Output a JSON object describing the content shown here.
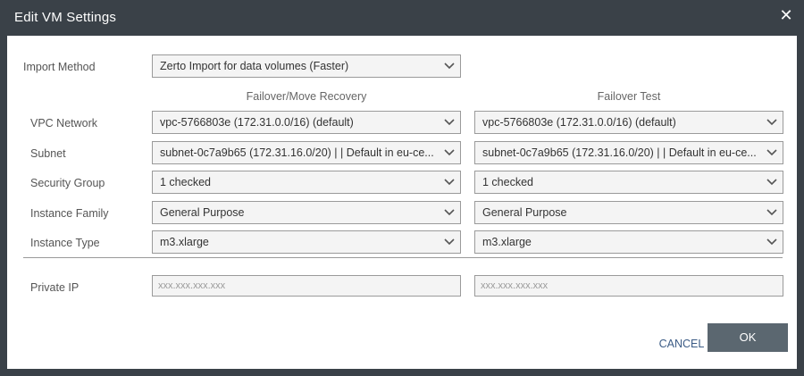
{
  "dialog": {
    "title": "Edit VM Settings",
    "close_glyph": "✕"
  },
  "import_method": {
    "label": "Import Method",
    "value": "Zerto Import for data volumes (Faster)"
  },
  "columns": {
    "recovery": "Failover/Move Recovery",
    "test": "Failover Test"
  },
  "rows": {
    "vpc": {
      "label": "VPC Network",
      "recovery": "vpc-5766803e (172.31.0.0/16) (default)",
      "test": "vpc-5766803e (172.31.0.0/16) (default)"
    },
    "subnet": {
      "label": "Subnet",
      "recovery": "subnet-0c7a9b65 (172.31.16.0/20) | | Default in eu-ce...",
      "test": "subnet-0c7a9b65 (172.31.16.0/20) | | Default in eu-ce..."
    },
    "security_group": {
      "label": "Security Group",
      "recovery": "1 checked",
      "test": "1 checked"
    },
    "instance_family": {
      "label": "Instance Family",
      "recovery": "General Purpose",
      "test": "General Purpose"
    },
    "instance_type": {
      "label": "Instance Type",
      "recovery": "m3.xlarge",
      "test": "m3.xlarge"
    }
  },
  "private_ip": {
    "label": "Private IP",
    "recovery_placeholder": "xxx.xxx.xxx.xxx",
    "test_placeholder": "xxx.xxx.xxx.xxx"
  },
  "footer": {
    "cancel_label": "CANCEL",
    "ok_label": "OK"
  },
  "colors": {
    "titlebar": "#3a4148",
    "ok_button": "#5b6770",
    "cancel_text": "#3b5b85"
  },
  "icons": {
    "close": "close-icon",
    "dropdown": "chevron-down-icon"
  }
}
